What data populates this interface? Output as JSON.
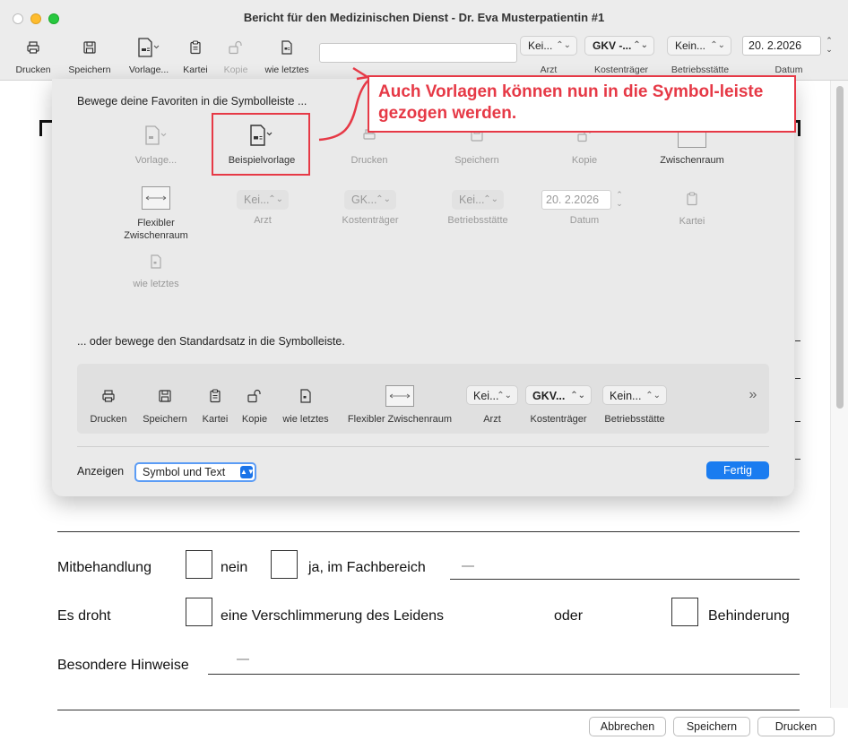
{
  "window": {
    "title": "Bericht für den Medizinischen Dienst -  Dr. Eva Musterpatientin #1"
  },
  "toolbar": {
    "items": [
      {
        "label": "Drucken",
        "icon": "printer-icon"
      },
      {
        "label": "Speichern",
        "icon": "floppy-icon"
      },
      {
        "label": "Vorlage...",
        "icon": "template-icon"
      },
      {
        "label": "Kartei",
        "icon": "clipboard-icon"
      },
      {
        "label": "Kopie",
        "icon": "lock-open-icon"
      },
      {
        "label": "wie letztes",
        "icon": "document-icon"
      }
    ],
    "search_value": "",
    "arzt": {
      "value": "Kei...",
      "label": "Arzt"
    },
    "kostentraeger": {
      "value": "GKV -...",
      "label": "Kostenträger"
    },
    "betriebsstaette": {
      "value": "Kein...",
      "label": "Betriebsstätte"
    },
    "datum": {
      "value": "20.  2.2026",
      "label": "Datum"
    }
  },
  "callout": {
    "text": "Auch Vorlagen können nun in die Symbol-leiste gezogen werden."
  },
  "sheet": {
    "favorites_heading": "Bewege deine Favoriten in die Symbolleiste ...",
    "palette": [
      {
        "label": "Vorlage..."
      },
      {
        "label": "Beispielvorlage"
      },
      {
        "label": "Drucken"
      },
      {
        "label": "Speichern"
      },
      {
        "label": "Kopie"
      },
      {
        "label": "Zwischenraum"
      },
      {
        "label": "Flexibler Zwischenraum"
      },
      {
        "label": "Arzt",
        "value": "Kei..."
      },
      {
        "label": "Kostenträger",
        "value": "GK..."
      },
      {
        "label": "Betriebsstätte",
        "value": "Kei..."
      },
      {
        "label": "Datum",
        "value": "20.  2.2026"
      },
      {
        "label": "Kartei"
      },
      {
        "label": "wie letztes"
      }
    ],
    "default_heading": "... oder bewege den Standardsatz in die Symbolleiste.",
    "default_set": [
      {
        "label": "Drucken"
      },
      {
        "label": "Speichern"
      },
      {
        "label": "Kartei"
      },
      {
        "label": "Kopie"
      },
      {
        "label": "wie letztes"
      },
      {
        "label": "Flexibler Zwischenraum"
      },
      {
        "label": "Arzt",
        "value": "Kei..."
      },
      {
        "label": "Kostenträger",
        "value": "GKV..."
      },
      {
        "label": "Betriebsstätte",
        "value": "Kein..."
      }
    ],
    "overflow": "»",
    "show_label": "Anzeigen",
    "show_value": "Symbol und Text",
    "done_label": "Fertig"
  },
  "form": {
    "mitbehandlung": "Mitbehandlung",
    "nein": "nein",
    "ja": "ja, im Fachbereich",
    "es_droht": "Es droht",
    "verschlimmerung": "eine Verschlimmerung des Leidens",
    "oder": "oder",
    "behinderung": "Behinderung",
    "hinweise": "Besondere Hinweise"
  },
  "buttons": {
    "cancel": "Abbrechen",
    "save": "Speichern",
    "print": "Drucken"
  }
}
